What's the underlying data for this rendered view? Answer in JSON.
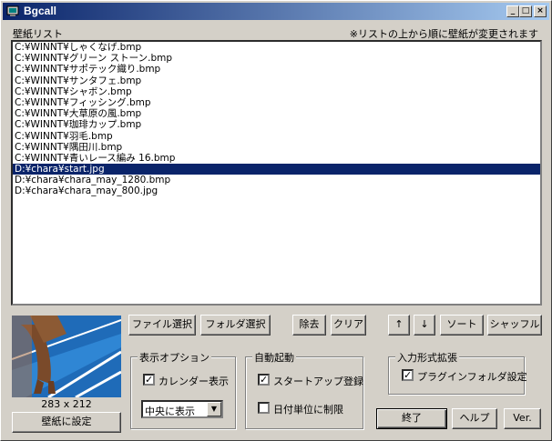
{
  "window": {
    "title": "Bgcall"
  },
  "labels": {
    "list_header": "壁紙リスト",
    "hint": "※リストの上から順に壁紙が変更されます",
    "thumb_size": "283 x 212"
  },
  "wallpapers": [
    "C:¥WINNT¥しゃくなげ.bmp",
    "C:¥WINNT¥グリーン ストーン.bmp",
    "C:¥WINNT¥サポテック織り.bmp",
    "C:¥WINNT¥サンタフェ.bmp",
    "C:¥WINNT¥シャボン.bmp",
    "C:¥WINNT¥フィッシング.bmp",
    "C:¥WINNT¥大草原の風.bmp",
    "C:¥WINNT¥珈琲カップ.bmp",
    "C:¥WINNT¥羽毛.bmp",
    "C:¥WINNT¥隅田川.bmp",
    "C:¥WINNT¥青いレース編み 16.bmp",
    "D:¥chara¥start.jpg",
    "D:¥chara¥chara_may_1280.bmp",
    "D:¥chara¥chara_may_800.jpg"
  ],
  "selected_index": 11,
  "buttons": {
    "file_select": "ファイル選択",
    "folder_select": "フォルダ選択",
    "remove": "除去",
    "clear": "クリア",
    "up": "↑",
    "down": "↓",
    "sort": "ソート",
    "shuffle": "シャッフル",
    "set_wallpaper": "壁紙に設定",
    "exit": "終了",
    "help": "ヘルプ",
    "ver": "Ver."
  },
  "display_options": {
    "title": "表示オプション",
    "calendar_label": "カレンダー表示",
    "calendar_checked": true,
    "position_value": "中央に表示"
  },
  "autostart": {
    "title": "自動起動",
    "startup_label": "スタートアップ登録",
    "startup_checked": true,
    "daily_label": "日付単位に制限",
    "daily_checked": false
  },
  "input_ext": {
    "title": "入力形式拡張",
    "plugin_label": "プラグインフォルダ設定",
    "plugin_checked": true
  }
}
